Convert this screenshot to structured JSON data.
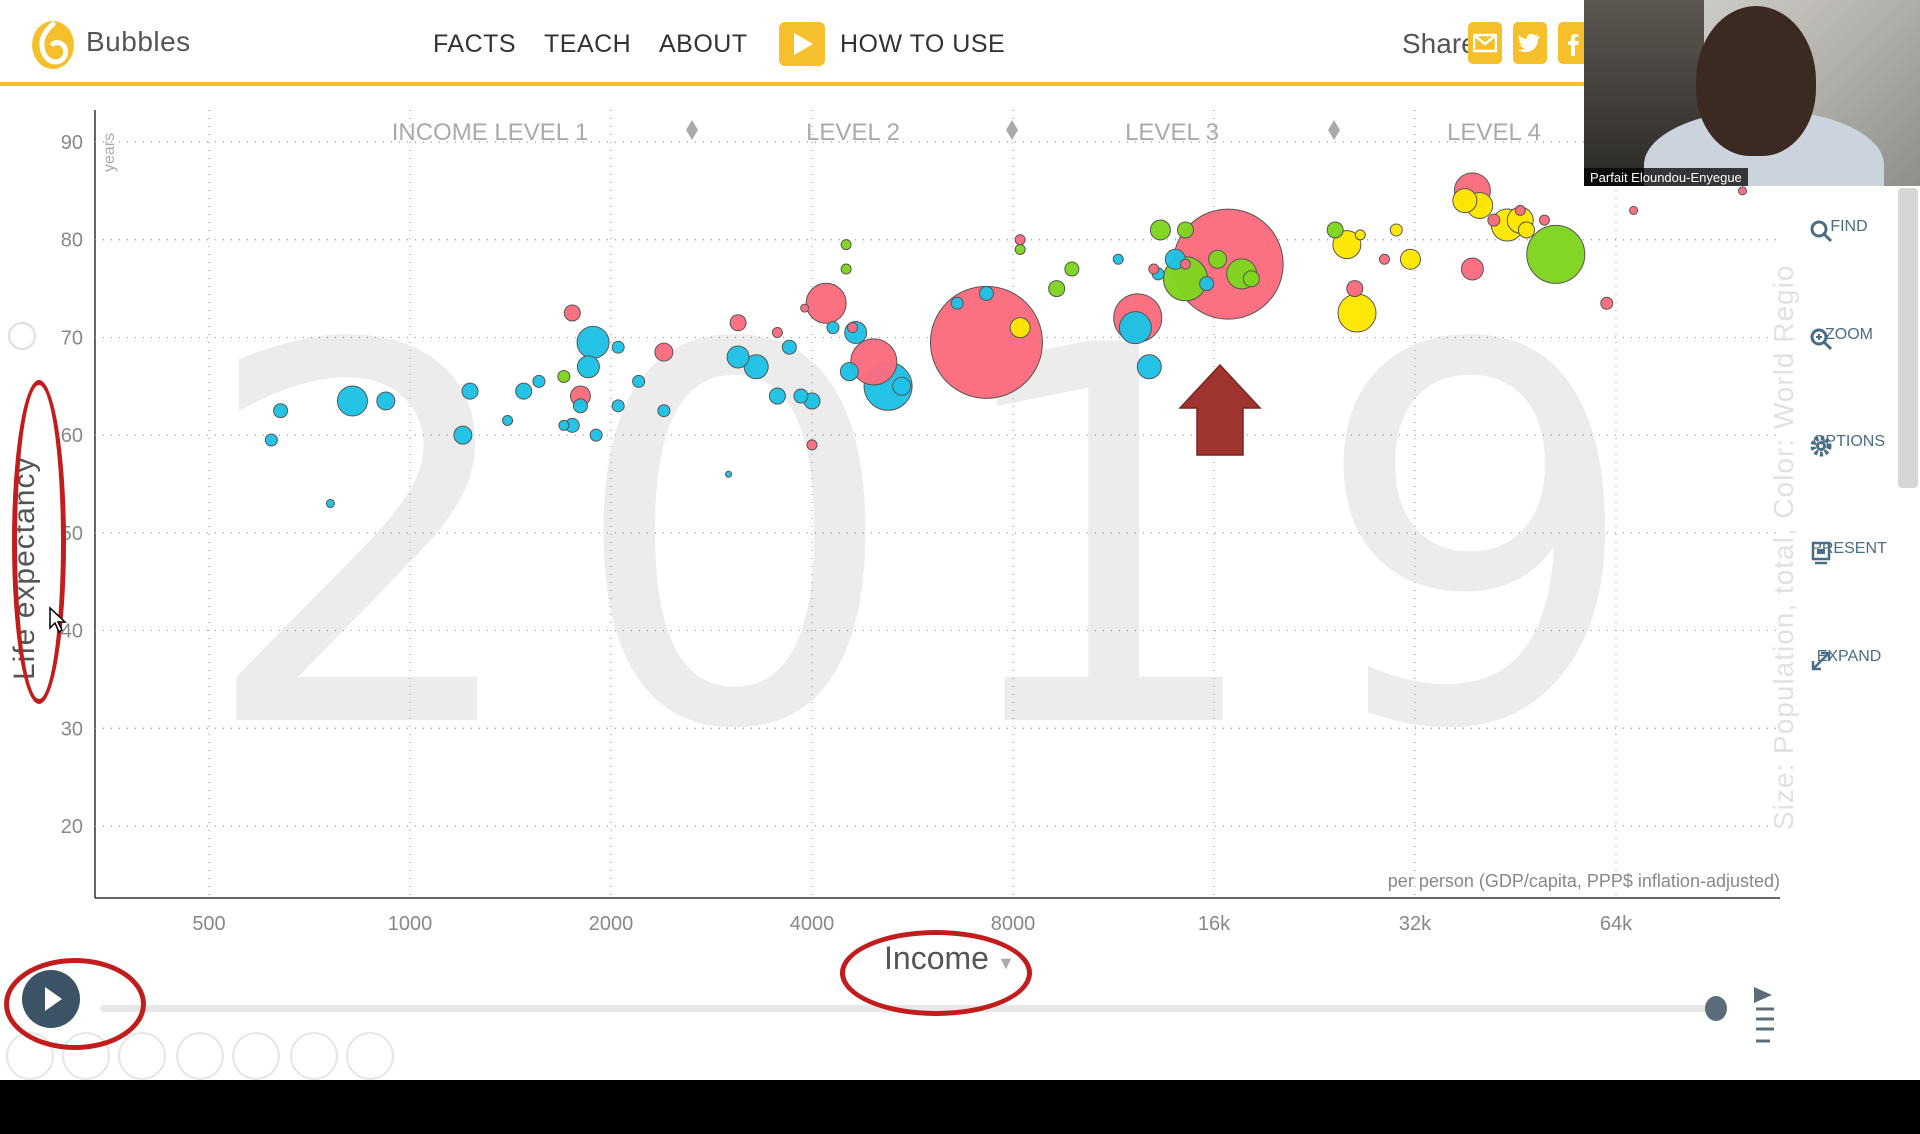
{
  "app": {
    "brand": "Bubbles"
  },
  "nav": {
    "facts": "FACTS",
    "teach": "TEACH",
    "about": "ABOUT",
    "how_to_use": "HOW TO USE"
  },
  "share": {
    "label": "Share"
  },
  "webcam": {
    "name": "Parfait Eloundou-Enyegue"
  },
  "right_tools": [
    "FIND",
    "ZOOM",
    "OPTIONS",
    "PRESENT",
    "EXPAND"
  ],
  "chart": {
    "year": "2019",
    "levels": [
      "INCOME LEVEL 1",
      "LEVEL 2",
      "LEVEL 3",
      "LEVEL 4"
    ],
    "y_label": "Life expectancy",
    "y_unit": "years",
    "x_label": "Income",
    "x_unit": "per person (GDP/capita, PPP$ inflation-adjusted)",
    "size_color_label": "Size: Population, total, Color: World Regio",
    "y_ticks": [
      "90",
      "80",
      "70",
      "60",
      "50",
      "40",
      "30",
      "20"
    ],
    "x_ticks": [
      "500",
      "1000",
      "2000",
      "4000",
      "8000",
      "16k",
      "32k",
      "64k"
    ],
    "colors": {
      "blue": "#1ec2e5",
      "red": "#fb6c7e",
      "green": "#7fd51e",
      "yellow": "#ffe700",
      "accent": "#f6c02c",
      "annotation": "#c21c1c",
      "arrow": "#a0342e"
    }
  },
  "chart_data": {
    "type": "scatter",
    "title": "2019",
    "xlabel": "Income",
    "ylabel": "Life expectancy",
    "x_scale": "log",
    "xlim": [
      350,
      110000
    ],
    "ylim": [
      15,
      92
    ],
    "series": [
      {
        "color": "#1ec2e5",
        "points": [
          {
            "x": 620,
            "y": 59.5,
            "r": 6
          },
          {
            "x": 640,
            "y": 62.5,
            "r": 7
          },
          {
            "x": 760,
            "y": 53,
            "r": 4
          },
          {
            "x": 820,
            "y": 63.5,
            "r": 15
          },
          {
            "x": 920,
            "y": 63.5,
            "r": 9
          },
          {
            "x": 1200,
            "y": 60,
            "r": 9
          },
          {
            "x": 1230,
            "y": 64.5,
            "r": 8
          },
          {
            "x": 1400,
            "y": 61.5,
            "r": 5
          },
          {
            "x": 1480,
            "y": 64.5,
            "r": 8
          },
          {
            "x": 1560,
            "y": 65.5,
            "r": 6
          },
          {
            "x": 1700,
            "y": 61,
            "r": 5
          },
          {
            "x": 1750,
            "y": 61,
            "r": 7
          },
          {
            "x": 1800,
            "y": 63,
            "r": 7
          },
          {
            "x": 1850,
            "y": 67,
            "r": 11
          },
          {
            "x": 1880,
            "y": 69.5,
            "r": 16
          },
          {
            "x": 1900,
            "y": 60,
            "r": 6
          },
          {
            "x": 2050,
            "y": 69,
            "r": 6
          },
          {
            "x": 2050,
            "y": 63,
            "r": 6
          },
          {
            "x": 2200,
            "y": 65.5,
            "r": 6
          },
          {
            "x": 2400,
            "y": 62.5,
            "r": 6
          },
          {
            "x": 3000,
            "y": 56,
            "r": 3
          },
          {
            "x": 3100,
            "y": 68,
            "r": 11
          },
          {
            "x": 3300,
            "y": 67,
            "r": 12
          },
          {
            "x": 3550,
            "y": 64,
            "r": 8
          },
          {
            "x": 3700,
            "y": 69,
            "r": 7
          },
          {
            "x": 3850,
            "y": 64,
            "r": 7
          },
          {
            "x": 4000,
            "y": 63.5,
            "r": 8
          },
          {
            "x": 4300,
            "y": 71,
            "r": 6
          },
          {
            "x": 4550,
            "y": 66.5,
            "r": 9
          },
          {
            "x": 4650,
            "y": 70.5,
            "r": 11
          },
          {
            "x": 5200,
            "y": 65,
            "r": 24
          },
          {
            "x": 5450,
            "y": 65,
            "r": 9
          },
          {
            "x": 6600,
            "y": 73.5,
            "r": 6
          },
          {
            "x": 7300,
            "y": 74.5,
            "r": 7
          },
          {
            "x": 11500,
            "y": 78,
            "r": 5
          },
          {
            "x": 12200,
            "y": 71,
            "r": 16
          },
          {
            "x": 12800,
            "y": 67,
            "r": 12
          },
          {
            "x": 13200,
            "y": 76.5,
            "r": 6
          },
          {
            "x": 14000,
            "y": 78,
            "r": 10
          },
          {
            "x": 15600,
            "y": 75.5,
            "r": 7
          }
        ]
      },
      {
        "color": "#fb6c7e",
        "points": [
          {
            "x": 1750,
            "y": 72.5,
            "r": 8
          },
          {
            "x": 1800,
            "y": 64,
            "r": 10
          },
          {
            "x": 2400,
            "y": 68.5,
            "r": 9
          },
          {
            "x": 3100,
            "y": 71.5,
            "r": 8
          },
          {
            "x": 3550,
            "y": 70.5,
            "r": 5
          },
          {
            "x": 3900,
            "y": 73,
            "r": 4
          },
          {
            "x": 4000,
            "y": 59,
            "r": 5
          },
          {
            "x": 4200,
            "y": 73.5,
            "r": 20
          },
          {
            "x": 4600,
            "y": 71,
            "r": 5
          },
          {
            "x": 4950,
            "y": 67.5,
            "r": 23
          },
          {
            "x": 7300,
            "y": 69.5,
            "r": 56
          },
          {
            "x": 8200,
            "y": 80,
            "r": 5
          },
          {
            "x": 12300,
            "y": 72,
            "r": 24
          },
          {
            "x": 13000,
            "y": 77,
            "r": 5
          },
          {
            "x": 14500,
            "y": 77.5,
            "r": 5
          },
          {
            "x": 16800,
            "y": 77.5,
            "r": 55
          },
          {
            "x": 26000,
            "y": 75,
            "r": 8
          },
          {
            "x": 28800,
            "y": 78,
            "r": 5
          },
          {
            "x": 39000,
            "y": 77,
            "r": 11
          },
          {
            "x": 39000,
            "y": 85,
            "r": 18
          },
          {
            "x": 42000,
            "y": 82,
            "r": 6
          },
          {
            "x": 46000,
            "y": 83,
            "r": 5
          },
          {
            "x": 50000,
            "y": 82,
            "r": 5
          },
          {
            "x": 62000,
            "y": 73.5,
            "r": 6
          },
          {
            "x": 68000,
            "y": 83,
            "r": 4
          },
          {
            "x": 99000,
            "y": 85,
            "r": 4
          }
        ]
      },
      {
        "color": "#7fd51e",
        "points": [
          {
            "x": 1700,
            "y": 66,
            "r": 6
          },
          {
            "x": 4500,
            "y": 77,
            "r": 5
          },
          {
            "x": 4500,
            "y": 79.5,
            "r": 5
          },
          {
            "x": 8200,
            "y": 79,
            "r": 5
          },
          {
            "x": 9300,
            "y": 75,
            "r": 8
          },
          {
            "x": 9800,
            "y": 77,
            "r": 7
          },
          {
            "x": 13300,
            "y": 81,
            "r": 10
          },
          {
            "x": 14500,
            "y": 81,
            "r": 8
          },
          {
            "x": 14500,
            "y": 76,
            "r": 22
          },
          {
            "x": 16200,
            "y": 78,
            "r": 9
          },
          {
            "x": 17600,
            "y": 76.5,
            "r": 15
          },
          {
            "x": 18200,
            "y": 76,
            "r": 8
          },
          {
            "x": 24300,
            "y": 81,
            "r": 8
          },
          {
            "x": 52000,
            "y": 78.5,
            "r": 29
          }
        ]
      },
      {
        "color": "#ffe700",
        "points": [
          {
            "x": 8200,
            "y": 71,
            "r": 10
          },
          {
            "x": 25300,
            "y": 79.5,
            "r": 14
          },
          {
            "x": 26200,
            "y": 72.5,
            "r": 19
          },
          {
            "x": 26500,
            "y": 80.5,
            "r": 5
          },
          {
            "x": 30000,
            "y": 81,
            "r": 6
          },
          {
            "x": 31500,
            "y": 78,
            "r": 10
          },
          {
            "x": 38000,
            "y": 84,
            "r": 12
          },
          {
            "x": 40000,
            "y": 83.5,
            "r": 13
          },
          {
            "x": 44000,
            "y": 81.5,
            "r": 16
          },
          {
            "x": 46000,
            "y": 82,
            "r": 13
          },
          {
            "x": 47000,
            "y": 81,
            "r": 8
          }
        ]
      }
    ]
  }
}
